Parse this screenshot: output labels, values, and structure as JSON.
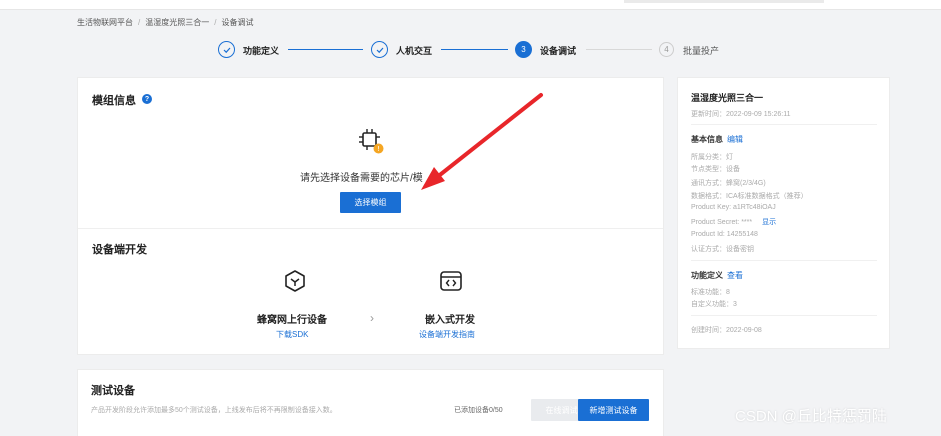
{
  "breadcrumb": [
    "生活物联网平台",
    "温湿度光照三合一",
    "设备调试"
  ],
  "steps": [
    {
      "label": "功能定义",
      "state": "done",
      "number": ""
    },
    {
      "label": "人机交互",
      "state": "done",
      "number": ""
    },
    {
      "label": "设备调试",
      "state": "active",
      "number": "3"
    },
    {
      "label": "批量投产",
      "state": "todo",
      "number": "4"
    }
  ],
  "module": {
    "title": "模组信息",
    "help": "?",
    "prompt": "请先选择设备需要的芯片/模",
    "select_button": "选择模组"
  },
  "device_dev": {
    "title": "设备端开发",
    "left": {
      "name": "蜂窝网上行设备",
      "link": "下载SDK"
    },
    "chevron": "›",
    "right": {
      "name": "嵌入式开发",
      "link": "设备端开发指南"
    }
  },
  "test": {
    "title": "测试设备",
    "desc": "产品开发阶段允许添加最多50个测试设备，上线发布后将不再限制设备接入数。",
    "count": "已添加设备0/50",
    "online_button": "在线调试",
    "add_button": "新增测试设备"
  },
  "info": {
    "product_name": "温湿度光照三合一",
    "updated": "更新时间：2022-09-09 15:26:11",
    "basic_title": "基本信息",
    "edit_link": "编辑",
    "basic_items": [
      "所属分类：灯",
      "节点类型：设备",
      "通讯方式：蜂窝(2/3/4G)",
      "数据格式：ICA标准数据格式（推荐）",
      "Product Key:  a1RTc48iOAJ",
      "Product Secret:  ****",
      "Product Id:  14255148",
      "认证方式：设备密钥"
    ],
    "show_link": "显示",
    "func_title": "功能定义",
    "view_link": "查看",
    "func_items": [
      "标准功能：8",
      "自定义功能：3"
    ],
    "created": "创建时间：2022-09-08"
  },
  "colors": {
    "accent": "#1a6fd4",
    "arrow": "#e8262a"
  },
  "watermark": "CSDN @丘比特惩罚陆"
}
